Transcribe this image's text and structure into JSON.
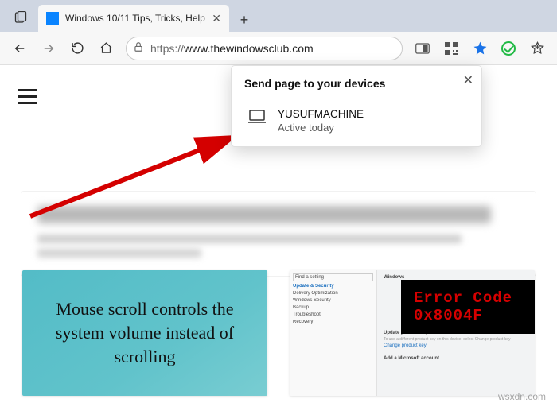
{
  "tab": {
    "title": "Windows 10/11 Tips, Tricks, Help"
  },
  "url": {
    "scheme": "https://",
    "host": "www.thewindowsclub.com"
  },
  "popover": {
    "title": "Send page to your devices",
    "device": {
      "name": "YUSUFMACHINE",
      "status": "Active today"
    }
  },
  "cards": {
    "left": {
      "text": "Mouse scroll controls the system volume instead of scrolling"
    },
    "right": {
      "error": "Error Code 0x8004F",
      "settings": {
        "search_placeholder": "Find a setting",
        "section": "Update & Security",
        "items": [
          "Delivery Optimization",
          "Windows Security",
          "Backup",
          "Troubleshoot",
          "Recovery"
        ]
      },
      "panel": {
        "header": "Windows",
        "sub": "Update product key",
        "link": "Change product key",
        "add": "Add a Microsoft account"
      }
    }
  },
  "watermark": "wsxdn.com"
}
